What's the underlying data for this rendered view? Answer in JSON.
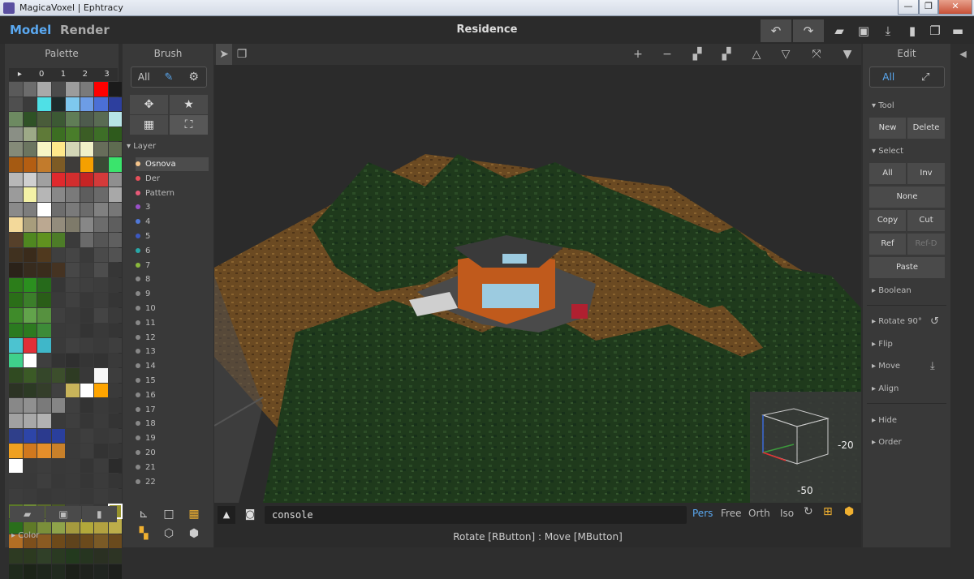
{
  "window": {
    "title": "MagicaVoxel | Ephtracy",
    "min": "—",
    "max": "❐",
    "close": "✕"
  },
  "modes": {
    "model": "Model",
    "render": "Render"
  },
  "scene_title": "Residence",
  "palette": {
    "title": "Palette",
    "header": [
      "▸",
      "0",
      "1",
      "2",
      "3"
    ],
    "footer_label": "Color",
    "colors": [
      "#5a5a5a",
      "#6c6c6c",
      "#a9a9a9",
      "#4b4b4b",
      "#9c9c9c",
      "#7a7a7a",
      "#ff0000",
      "#1b1b1b",
      "#4f4f4f",
      "#3b3b3b",
      "#4fe0e6",
      "#1d2a2a",
      "#7ec8ee",
      "#6d9de6",
      "#4b6fd6",
      "#2d3f9e",
      "#6d8a61",
      "#2f5226",
      "#4a5c3a",
      "#3c5934",
      "#607d56",
      "#4e5b4d",
      "#596b53",
      "#b7e4e6",
      "#8a8f85",
      "#9da987",
      "#5f7a38",
      "#3c6e22",
      "#497d2a",
      "#3b5d25",
      "#3d6e27",
      "#2e5a1c",
      "#848a78",
      "#6b7560",
      "#f7f5c4",
      "#ffe88a",
      "#d3d6b6",
      "#f0f0c8",
      "#676d5a",
      "#5e6b50",
      "#a55a12",
      "#b45e12",
      "#c27b2c",
      "#7d5b25",
      "#3e3c3a",
      "#f5a000",
      "#3b4a35",
      "#3ae46c",
      "#b8b8b8",
      "#d0d0d0",
      "#a0a0a0",
      "#e0292d",
      "#d22e2e",
      "#c62424",
      "#d43a3a",
      "#8f8f8f",
      "#9b9b9b",
      "#f4f2a6",
      "#b6b6b6",
      "#888888",
      "#7a7a7a",
      "#5d5d5d",
      "#6a6a6a",
      "#a8a8a8",
      "#8a8a8a",
      "#7d7d7d",
      "#ffffff",
      "#6d6d6d",
      "#7a7a7a",
      "#6b6b6b",
      "#808080",
      "#777777",
      "#f3d99a",
      "#a89d7c",
      "#bba891",
      "#938c7c",
      "#7e7a6a",
      "#878787",
      "#6c6c6c",
      "#5e5e5e",
      "#56402a",
      "#4f8720",
      "#60921f",
      "#4d7c28",
      "#3b3b3b",
      "#6a6a6a",
      "#555555",
      "#5f5f5f",
      "#40311f",
      "#3a2b1b",
      "#50391e",
      "#3f3f3f",
      "#454545",
      "#3a3a3a",
      "#4a4a4a",
      "#525252",
      "#2b2219",
      "#372b1e",
      "#3a2c1c",
      "#453322",
      "#474747",
      "#3e3e3e",
      "#4d4d4d",
      "#363636",
      "#2c7d1a",
      "#2b8f1f",
      "#266a1b",
      "#363636",
      "#424242",
      "#3f3f3f",
      "#3d3d3d",
      "#383838",
      "#2b6e18",
      "#3b7e2a",
      "#2a5d18",
      "#3a3a3a",
      "#404040",
      "#383838",
      "#3c3c3c",
      "#353535",
      "#3f8b2a",
      "#62a34b",
      "#56913f",
      "#3f3f3f",
      "#3a3a3a",
      "#363636",
      "#444444",
      "#3a3a3a",
      "#2b7a20",
      "#2d7a20",
      "#3d8b38",
      "#3a3a3a",
      "#3b3b3b",
      "#343434",
      "#393939",
      "#353535",
      "#4cc3d0",
      "#e02f38",
      "#3fb7c9",
      "#3a3a3a",
      "#404040",
      "#3d3d3d",
      "#3a3a3a",
      "#3e3e3e",
      "#3fd08b",
      "#ffffff",
      "#3f3f3f",
      "#333333",
      "#2f2f2f",
      "#353535",
      "#333333",
      "#3a3a3a",
      "#304a21",
      "#3b5a26",
      "#35472a",
      "#3c4e2c",
      "#2e3b23",
      "#383838",
      "#f7f7f7",
      "#3d3d3d",
      "#2c3324",
      "#2c3a24",
      "#343e2a",
      "#404040",
      "#c8b45a",
      "#ffffff",
      "#ffa500",
      "#3a3a3a",
      "#888888",
      "#909090",
      "#7a7a7a",
      "#858585",
      "#3f3f3f",
      "#333333",
      "#3a3a3a",
      "#363636",
      "#a1a1a1",
      "#a8a8a8",
      "#b2b2b2",
      "#3a3a3a",
      "#3e3e3e",
      "#363636",
      "#3b3b3b",
      "#343434",
      "#2f3f8a",
      "#2d45a8",
      "#2b3a8e",
      "#2a3f9c",
      "#3a3a3a",
      "#3e3e3e",
      "#393939",
      "#3b3b3b",
      "#f0a020",
      "#d0781e",
      "#e58e2a",
      "#c8802a",
      "#3a3a3a",
      "#3d3d3d",
      "#333333",
      "#363636",
      "#ffffff",
      "#3a3a3a",
      "#3d3d3d",
      "#393939",
      "#3a3a3a",
      "#353535",
      "#3c3c3c",
      "#2b2b2b",
      "#3a3a3a",
      "#393939",
      "#3e3e3e",
      "#383838",
      "#3a3a3a",
      "#363636",
      "#3b3b3b",
      "#353535",
      "#3d3d3d",
      "#3b3b3b",
      "#383838",
      "#3a3a3a",
      "#3a3a3a",
      "#383838",
      "#3c3c3c",
      "#393939",
      "#5c7a28",
      "#6e8a36",
      "#5a6b2a",
      "#4a5a26",
      "#3f3f3f",
      "#3d3d3d",
      "#383838",
      "#97932c",
      "#2a6e1c",
      "#5f7a28",
      "#7a8f3a",
      "#8fa34a",
      "#a59a3e",
      "#b2a83a",
      "#b3a240",
      "#bcae4a",
      "#b36e24",
      "#7d4f1c",
      "#8a5a22",
      "#6e4a1a",
      "#5f431c",
      "#6b4a1c",
      "#7a5a26",
      "#6a4a1d",
      "#2d3a22",
      "#2c3a20",
      "#304028",
      "#2a3a22",
      "#233a1e",
      "#263520",
      "#2a3022",
      "#2d3424",
      "#1f2a1c",
      "#1c2418",
      "#1e261c",
      "#212a1f",
      "#1c2019",
      "#1f221d",
      "#202420",
      "#1d1f1c"
    ]
  },
  "brush": {
    "title": "Brush",
    "all": "All",
    "layer_label": "Layer",
    "layers": [
      {
        "name": "Osnova",
        "color": "#f4c48a"
      },
      {
        "name": "Der",
        "color": "#e8505a"
      },
      {
        "name": "Pattern",
        "color": "#e85a78"
      },
      {
        "name": "3",
        "color": "#9a50c8"
      },
      {
        "name": "4",
        "color": "#5078d8"
      },
      {
        "name": "5",
        "color": "#3c58c0"
      },
      {
        "name": "6",
        "color": "#28a8a8"
      },
      {
        "name": "7",
        "color": "#8ab83c"
      },
      {
        "name": "8",
        "color": "#888888"
      },
      {
        "name": "9",
        "color": "#888888"
      },
      {
        "name": "10",
        "color": "#888888"
      },
      {
        "name": "11",
        "color": "#888888"
      },
      {
        "name": "12",
        "color": "#888888"
      },
      {
        "name": "13",
        "color": "#888888"
      },
      {
        "name": "14",
        "color": "#888888"
      },
      {
        "name": "15",
        "color": "#888888"
      },
      {
        "name": "16",
        "color": "#888888"
      },
      {
        "name": "17",
        "color": "#888888"
      },
      {
        "name": "18",
        "color": "#888888"
      },
      {
        "name": "19",
        "color": "#888888"
      },
      {
        "name": "20",
        "color": "#888888"
      },
      {
        "name": "21",
        "color": "#888888"
      },
      {
        "name": "22",
        "color": "#888888"
      }
    ]
  },
  "console": {
    "value": "console"
  },
  "views": [
    "Pers",
    "Free",
    "Orth",
    "Iso"
  ],
  "axis": {
    "y": "-20",
    "x": "-50"
  },
  "status": "Rotate [RButton] : Move [MButton]",
  "edit": {
    "title": "Edit",
    "all": "All",
    "tool": "Tool",
    "new": "New",
    "delete": "Delete",
    "select": "Select",
    "sel_all": "All",
    "inv": "Inv",
    "none": "None",
    "copy": "Copy",
    "cut": "Cut",
    "ref": "Ref",
    "refd": "Ref-D",
    "paste": "Paste",
    "boolean": "Boolean",
    "rotate": "Rotate 90°",
    "flip": "Flip",
    "move": "Move",
    "align": "Align",
    "hide": "Hide",
    "order": "Order"
  },
  "accent": "#5aa8f0"
}
